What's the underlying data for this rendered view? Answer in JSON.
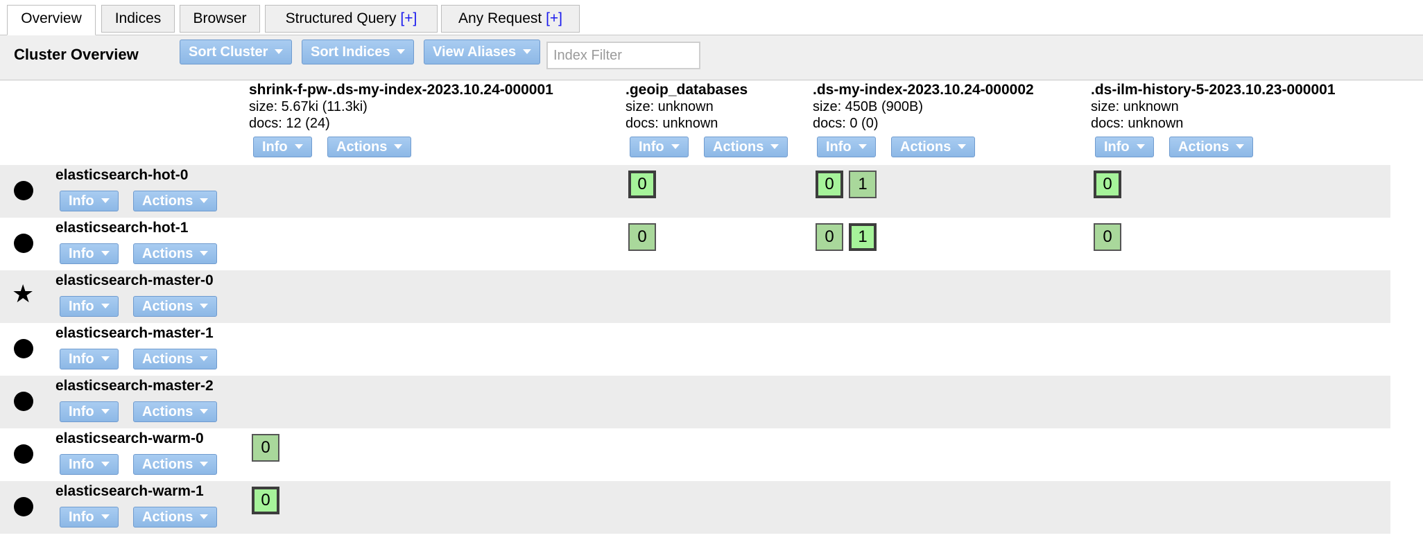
{
  "tabs": [
    {
      "label": "Overview"
    },
    {
      "label": "Indices"
    },
    {
      "label": "Browser"
    },
    {
      "label": "Structured Query",
      "plus": "[+]"
    },
    {
      "label": "Any Request",
      "plus": "[+]"
    }
  ],
  "toolbar": {
    "title": "Cluster Overview",
    "sort_cluster": "Sort Cluster",
    "sort_indices": "Sort Indices",
    "view_aliases": "View Aliases",
    "filter_placeholder": "Index Filter"
  },
  "indices": [
    {
      "name": "shrink-f-pw-.ds-my-index-2023.10.24-000001",
      "size": "size: 5.67ki (11.3ki)",
      "docs": "docs: 12 (24)",
      "info": "Info",
      "actions": "Actions"
    },
    {
      "name": ".geoip_databases",
      "size": "size: unknown",
      "docs": "docs: unknown",
      "info": "Info",
      "actions": "Actions"
    },
    {
      "name": ".ds-my-index-2023.10.24-000002",
      "size": "size: 450B (900B)",
      "docs": "docs: 0 (0)",
      "info": "Info",
      "actions": "Actions"
    },
    {
      "name": ".ds-ilm-history-5-2023.10.23-000001",
      "size": "size: unknown",
      "docs": "docs: unknown",
      "info": "Info",
      "actions": "Actions"
    }
  ],
  "nodes": [
    {
      "name": "elasticsearch-hot-0",
      "info": "Info",
      "actions": "Actions",
      "master": false
    },
    {
      "name": "elasticsearch-hot-1",
      "info": "Info",
      "actions": "Actions",
      "master": false
    },
    {
      "name": "elasticsearch-master-0",
      "info": "Info",
      "actions": "Actions",
      "master": true
    },
    {
      "name": "elasticsearch-master-1",
      "info": "Info",
      "actions": "Actions",
      "master": false
    },
    {
      "name": "elasticsearch-master-2",
      "info": "Info",
      "actions": "Actions",
      "master": false
    },
    {
      "name": "elasticsearch-warm-0",
      "info": "Info",
      "actions": "Actions",
      "master": false
    },
    {
      "name": "elasticsearch-warm-1",
      "info": "Info",
      "actions": "Actions",
      "master": false
    }
  ],
  "shards": {
    "hot0_geoip": "0",
    "hot0_myidx2_a": "0",
    "hot0_myidx2_b": "1",
    "hot0_ilm": "0",
    "hot1_geoip": "0",
    "hot1_myidx2_a": "0",
    "hot1_myidx2_b": "1",
    "hot1_ilm": "0",
    "warm0_shrink": "0",
    "warm1_shrink": "0"
  },
  "colors": {
    "primary_shard": "#a6f39a",
    "replica_shard": "#a9d89b",
    "button": "#8db8e6"
  }
}
